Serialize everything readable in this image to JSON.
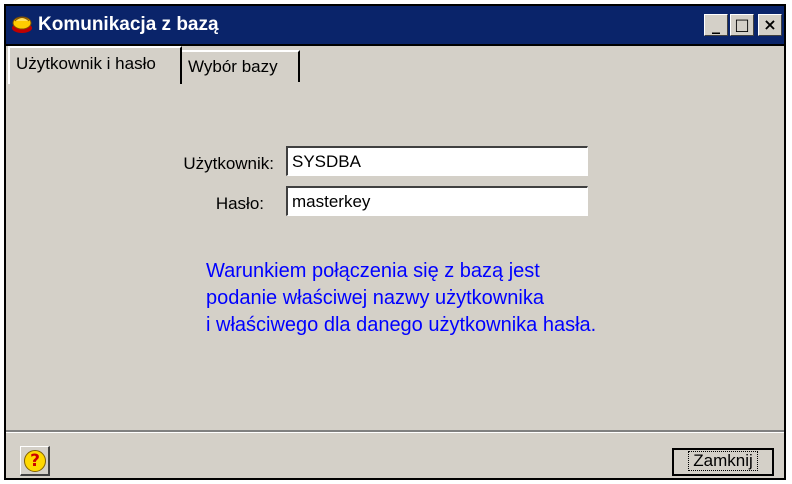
{
  "window": {
    "title": "Komunikacja z bazą",
    "controls": {
      "minimize": "_",
      "maximize": "□",
      "close": "×"
    }
  },
  "tabs": [
    {
      "label": "Użytkownik i hasło",
      "active": true
    },
    {
      "label": "Wybór bazy",
      "active": false
    }
  ],
  "form": {
    "user_label": "Użytkownik:",
    "user_value": "SYSDBA",
    "password_label": "Hasło:",
    "password_value": "masterkey"
  },
  "info_lines": [
    "Warunkiem połączenia się z bazą jest",
    "podanie właściwej nazwy użytkownika",
    "i właściwego dla danego użytkownika hasła."
  ],
  "footer": {
    "help_icon": "question-mark",
    "help_glyph": "?",
    "close_label": "Zamknij"
  },
  "colors": {
    "titlebar": "#0a246a",
    "info_text": "#0000ff",
    "face": "#d4d0c8"
  }
}
